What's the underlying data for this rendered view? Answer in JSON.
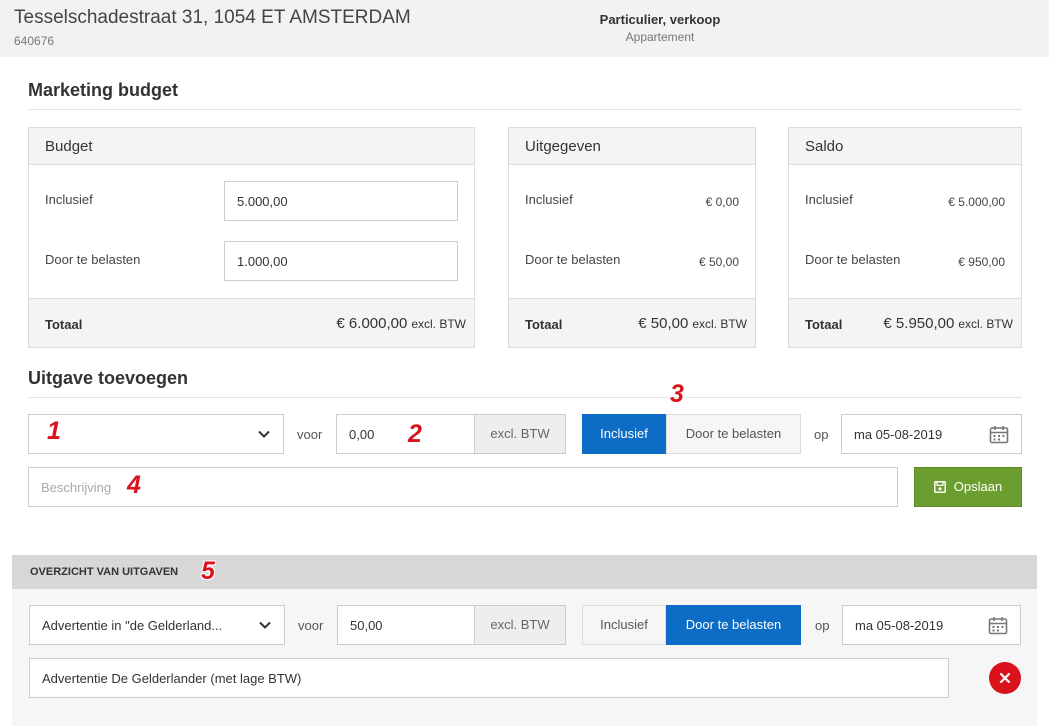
{
  "header": {
    "address": "Tesselschadestraat 31, 1054 ET AMSTERDAM",
    "object_id": "640676",
    "type": "Particulier, verkoop",
    "subtype": "Appartement"
  },
  "marketing": {
    "title": "Marketing budget",
    "budget": {
      "title": "Budget",
      "inclusive_label": "Inclusief",
      "inclusive_value": "5.000,00",
      "charge_label": "Door te belasten",
      "charge_value": "1.000,00",
      "total_label": "Totaal",
      "total_value": "€ 6.000,00",
      "total_suffix": "excl. BTW"
    },
    "spent": {
      "title": "Uitgegeven",
      "inclusive_label": "Inclusief",
      "inclusive_value": "€ 0,00",
      "charge_label": "Door te belasten",
      "charge_value": "€ 50,00",
      "total_label": "Totaal",
      "total_value": "€ 50,00",
      "total_suffix": "excl. BTW"
    },
    "balance": {
      "title": "Saldo",
      "inclusive_label": "Inclusief",
      "inclusive_value": "€ 5.000,00",
      "charge_label": "Door te belasten",
      "charge_value": "€ 950,00",
      "total_label": "Totaal",
      "total_value": "€ 5.950,00",
      "total_suffix": "excl. BTW"
    }
  },
  "add_expense": {
    "title": "Uitgave toevoegen",
    "category_value": "",
    "for_label": "voor",
    "amount_value": "0,00",
    "amount_suffix": "excl. BTW",
    "toggle_inclusive": "Inclusief",
    "toggle_charge": "Door te belasten",
    "active_toggle": "Inclusief",
    "on_label": "op",
    "date_value": "ma 05-08-2019",
    "description_placeholder": "Beschrijving",
    "save_label": "Opslaan"
  },
  "overview": {
    "title": "OVERZICHT VAN UITGAVEN",
    "items": [
      {
        "category": "Advertentie in \"de Gelderland...",
        "for_label": "voor",
        "amount": "50,00",
        "amount_suffix": "excl. BTW",
        "toggle_inclusive": "Inclusief",
        "toggle_charge": "Door te belasten",
        "active_toggle": "Door te belasten",
        "on_label": "op",
        "date": "ma 05-08-2019",
        "description": "Advertentie De Gelderlander (met lage BTW)"
      }
    ]
  },
  "markers": [
    "1",
    "2",
    "3",
    "4",
    "5"
  ],
  "colors": {
    "primary": "#0d6cc5",
    "save": "#6b9e2e",
    "danger": "#d9121c",
    "marker": "#d9121c"
  }
}
